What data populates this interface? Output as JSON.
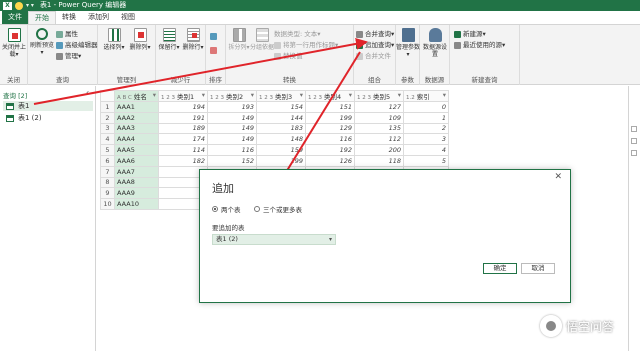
{
  "titlebar": {
    "title": "表1 - Power Query 编辑器",
    "quick_access": "▾ ▾"
  },
  "tabs": [
    {
      "label": "文件"
    },
    {
      "label": "开始"
    },
    {
      "label": "转换"
    },
    {
      "label": "添加列"
    },
    {
      "label": "视图"
    }
  ],
  "ribbon": {
    "close": {
      "btn": "关闭并上载▾",
      "group": "关闭"
    },
    "query": {
      "refresh": "刷新预览▾",
      "properties": "属性",
      "advanced_editor": "高级编辑器",
      "manage": "管理▾",
      "group": "查询"
    },
    "manage_cols": {
      "choose": "选择列▾",
      "remove": "删除列▾",
      "group": "管理列"
    },
    "reduce_rows": {
      "keep": "保留行▾",
      "remove": "删除行▾",
      "group": "减少行"
    },
    "sort": {
      "group": "排序"
    },
    "transform": {
      "split": "拆分列▾",
      "groupby": "分组依据",
      "datatype": "数据类型: 文本▾",
      "first_row": "将第一行用作标题▾",
      "replace": "替换值",
      "group": "转换"
    },
    "combine": {
      "merge": "合并查询▾",
      "append": "追加查询▾",
      "combine_files": "合并文件",
      "group": "组合"
    },
    "params": {
      "manage": "管理参数▾",
      "group": "参数"
    },
    "datasource": {
      "settings": "数据源设置",
      "group": "数据源"
    },
    "new_query": {
      "new_source": "新建源▾",
      "recent": "最近使用的源▾",
      "group": "新建查询"
    }
  },
  "queries": {
    "header": "查询 [2]",
    "collapse_icon": "‹",
    "items": [
      {
        "label": "表1"
      },
      {
        "label": "表1 (2)"
      }
    ]
  },
  "table": {
    "columns": [
      {
        "type": "A B C",
        "name": "姓名"
      },
      {
        "type": "1 2 3",
        "name": "类别1"
      },
      {
        "type": "1 2 3",
        "name": "类别2"
      },
      {
        "type": "1 2 3",
        "name": "类别3"
      },
      {
        "type": "1 2 3",
        "name": "类别4"
      },
      {
        "type": "1 2 3",
        "name": "类别5"
      },
      {
        "type": "1.2",
        "name": "索引"
      }
    ],
    "rows": [
      [
        "AAA1",
        "194",
        "193",
        "154",
        "151",
        "127",
        "0"
      ],
      [
        "AAA2",
        "191",
        "149",
        "144",
        "199",
        "109",
        "1"
      ],
      [
        "AAA3",
        "189",
        "149",
        "183",
        "129",
        "135",
        "2"
      ],
      [
        "AAA4",
        "174",
        "149",
        "148",
        "116",
        "112",
        "3"
      ],
      [
        "AAA5",
        "114",
        "116",
        "159",
        "192",
        "200",
        "4"
      ],
      [
        "AAA6",
        "182",
        "152",
        "199",
        "126",
        "118",
        "5"
      ],
      [
        "AAA7",
        "1",
        "",
        "",
        "",
        "",
        ""
      ],
      [
        "AAA8",
        "1",
        "",
        "",
        "",
        "",
        ""
      ],
      [
        "AAA9",
        "1",
        "",
        "",
        "",
        "",
        ""
      ],
      [
        "AAA10",
        "1",
        "",
        "",
        "",
        "",
        ""
      ]
    ]
  },
  "dialog": {
    "title": "追加",
    "close": "✕",
    "option1": "两个表",
    "option2": "三个或更多表",
    "table_label": "要追加的表",
    "selected_table": "表1 (2)",
    "ok": "确定",
    "cancel": "取消"
  },
  "watermark": {
    "text": "悟空问答"
  },
  "colors": {
    "accent": "#217346",
    "arrow": "#e0242a"
  }
}
